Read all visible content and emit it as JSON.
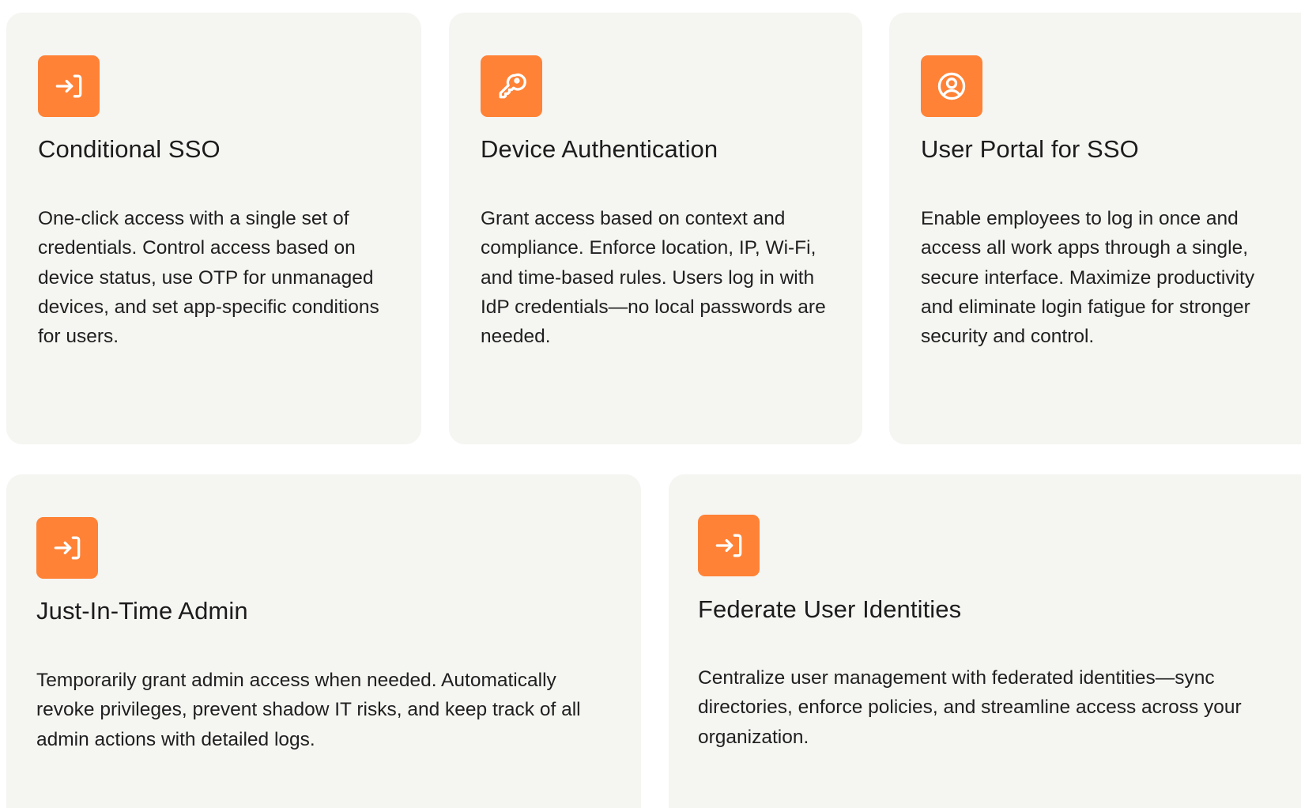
{
  "cards": [
    {
      "icon": "login-arrow-icon",
      "title": "Conditional SSO",
      "description": "One-click access with a single set of credentials. Control access based on device status, use OTP for unmanaged devices, and set app-specific conditions for users."
    },
    {
      "icon": "key-icon",
      "title": "Device Authentication",
      "description": "Grant access based on context and compliance. Enforce location, IP, Wi-Fi, and time-based rules. Users log in with IdP credentials—no local passwords are needed."
    },
    {
      "icon": "user-circle-icon",
      "title": "User Portal for SSO",
      "description": "Enable employees to log in once and access all work apps through a single, secure interface. Maximize productivity and eliminate login fatigue for stronger security and control."
    },
    {
      "icon": "login-arrow-icon",
      "title": "Just-In-Time Admin",
      "description": "Temporarily grant admin access when needed. Automatically revoke privileges, prevent shadow IT risks, and keep track of all admin actions with detailed logs."
    },
    {
      "icon": "login-arrow-icon",
      "title": "Federate User Identities",
      "description": "Centralize user management with federated identities—sync directories, enforce policies, and streamline access across your organization."
    }
  ],
  "colors": {
    "accent": "#ff8236",
    "card_background": "#f5f5f2",
    "text": "#1f1f1f"
  }
}
